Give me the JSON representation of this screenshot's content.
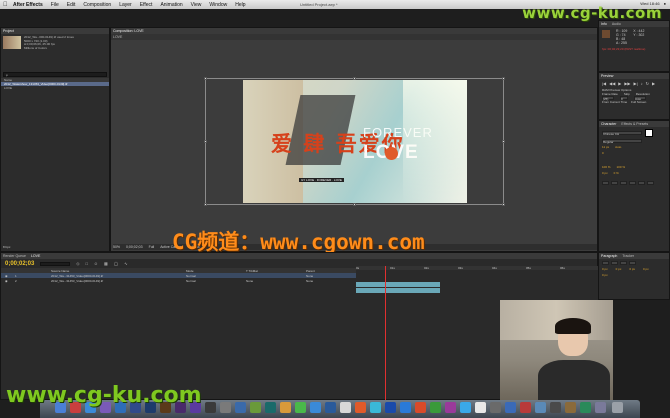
{
  "menubar": {
    "app_name": "After Effects",
    "items": [
      "File",
      "Edit",
      "Composition",
      "Layer",
      "Effect",
      "Animation",
      "View",
      "Window",
      "Help"
    ],
    "doc_title": "Untitled Project.aep *",
    "right_status": "Wed 18:46"
  },
  "watermarks": {
    "top_right": "www.cg-ku.com",
    "bottom_left": "www.cg-ku.com",
    "center": "CG频道：www.cgown.com"
  },
  "project_panel": {
    "tab": "Project",
    "footage_name": "2012_Wa...000-0149).tif",
    "footage_used": "used 2 times",
    "footage_lines": [
      "5000 x 720 (1.00)",
      "Δ 0;00;06;06, 25.00 fps",
      "Millions of Colors"
    ],
    "search_placeholder": "ρ",
    "col_name": "Name",
    "items": [
      "2012_Watershow_131453_Video[0000-0149].tif",
      "LOVE"
    ],
    "bottom_info": "8 bpc"
  },
  "composition_panel": {
    "tab_label": "Composition: LOVE",
    "sub_tab": "LOVE",
    "artwork": {
      "chinese_title": "爱 肆 吾爱你",
      "forever": "FOREVER",
      "love": "LOVE",
      "caption": "ILY LOVE · FOREVER · LOVE"
    },
    "zoom": "50%",
    "timecode": "0;00;02;03",
    "resolution": "Full",
    "camera": "Active Camera",
    "view": "1 View"
  },
  "info_panel": {
    "tabs": [
      "Info",
      "Audio"
    ],
    "values": [
      "R : 109",
      "G : 74",
      "B : 48",
      "A : 255"
    ],
    "coords": [
      "X : 442",
      "Y : 302"
    ],
    "footage_status": "fps: 00;02;23;20 (PAST realtime)"
  },
  "preview_panel": {
    "tabs": [
      "Preview"
    ],
    "ram_options": "RAM Preview Options",
    "labels": [
      "Frame Rate",
      "Skip",
      "Resolution"
    ],
    "values": [
      "(25)",
      "0",
      "Auto"
    ],
    "checks": [
      "From Current Time",
      "Full Screen"
    ]
  },
  "character_panel": {
    "tabs": [
      "Character",
      "Effects & Presets"
    ],
    "font": "Chinese CH",
    "style": "Regular",
    "size": "11 px",
    "leading": "Auto",
    "tracking": "0",
    "scale_v": "100 %",
    "scale_h": "100 %",
    "baseline": "0 px",
    "tsume": "0 %"
  },
  "paragraph_panel": {
    "tabs": [
      "Paragraph",
      "Tracker"
    ],
    "values": [
      "0 px",
      "0 px",
      "0 px",
      "0 px",
      "0 px"
    ]
  },
  "timeline": {
    "tabs": [
      "Render Queue",
      "LOVE"
    ],
    "timecode": "0;00;02;03",
    "col_headers": [
      "Source Name",
      "Mode",
      "T TrkMat",
      "Parent"
    ],
    "layers": [
      {
        "num": "1",
        "name": "2012_Wa...31453_Video[0000-0149].tif",
        "mode": "Normal",
        "parent": "None"
      },
      {
        "num": "2",
        "name": "2012_Wa...31453_Video[0000-0149].tif",
        "mode": "Normal",
        "trkmat": "None",
        "parent": "None"
      }
    ],
    "ruler_marks": [
      "0s",
      "01s",
      "02s",
      "03s",
      "04s",
      "05s",
      "06s"
    ]
  },
  "colors": {
    "watermark_green": "#7fc820",
    "cg_orange": "#ff8c1a",
    "ae_timecode": "#e8c12a",
    "playhead": "#e03030",
    "info_red": "#e04040"
  }
}
